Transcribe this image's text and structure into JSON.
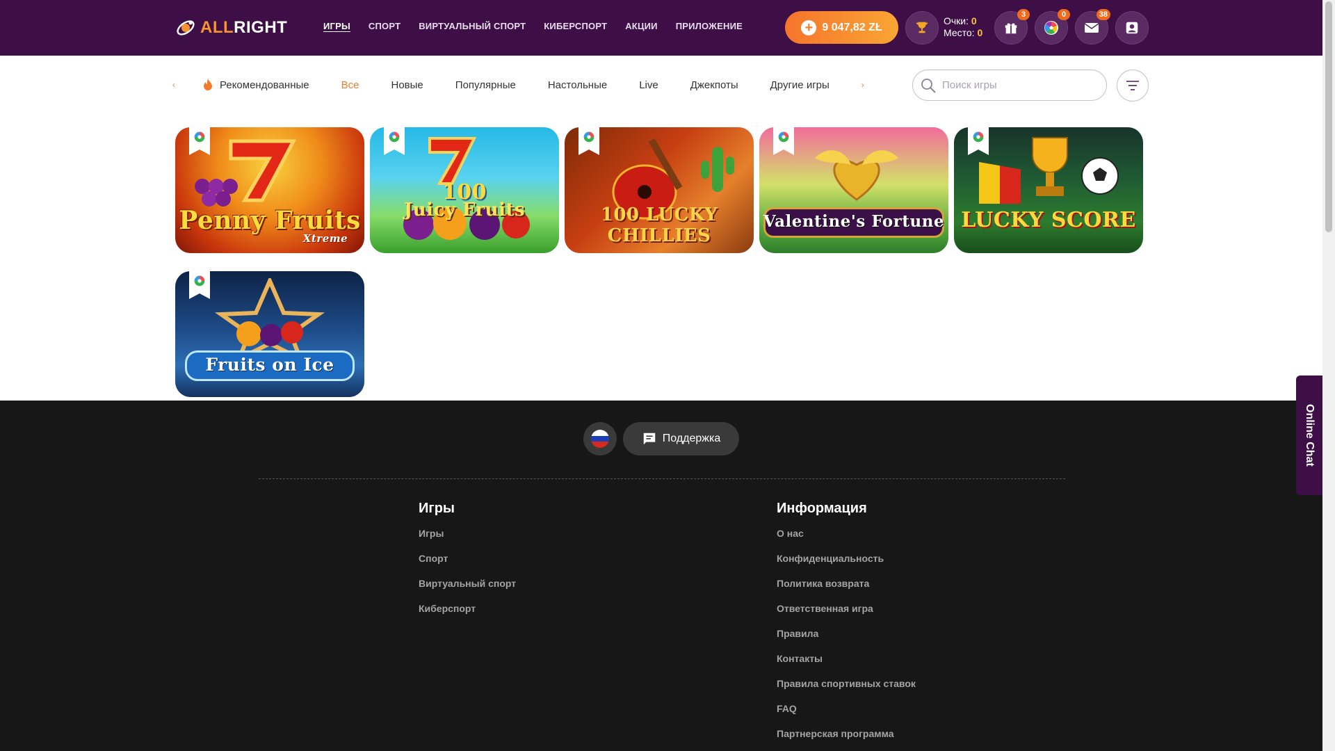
{
  "header": {
    "logo": {
      "prefix": "ALL",
      "suffix": "RIGHT"
    },
    "nav": [
      {
        "label": "ИГРЫ",
        "active": true
      },
      {
        "label": "СПОРТ"
      },
      {
        "label": "ВИРТУАЛЬНЫЙ СПОРТ"
      },
      {
        "label": "КИБЕРСПОРТ"
      },
      {
        "label": "АКЦИИ"
      },
      {
        "label": "ПРИЛОЖЕНИЕ"
      }
    ],
    "balance": "9 047,82 ZŁ",
    "points": {
      "points_label": "Очки:",
      "points_value": "0",
      "place_label": "Место:",
      "place_value": "0"
    },
    "badges": {
      "gifts": "3",
      "wheel": "0",
      "messages": "38"
    },
    "accent_color": "#f27a2c",
    "bg_color": "#3d0f46"
  },
  "categories": {
    "items": [
      "Рекомендованные",
      "Все",
      "Новые",
      "Популярные",
      "Настольные",
      "Live",
      "Джекпоты",
      "Другие игры"
    ],
    "active": "Все",
    "search_placeholder": "Поиск игры"
  },
  "games": [
    {
      "title": "Penny Fruits",
      "subtitle": "Xtreme"
    },
    {
      "title": "Juicy Fruits",
      "subtitle": "100"
    },
    {
      "title": "100 LUCKY CHILLIES",
      "subtitle": ""
    },
    {
      "title": "Valentine's Fortune",
      "subtitle": ""
    },
    {
      "title": "LUCKY SCORE",
      "subtitle": ""
    },
    {
      "title": "Fruits on Ice",
      "subtitle": ""
    }
  ],
  "footer": {
    "support_label": "Поддержка",
    "games_column": {
      "heading": "Игры",
      "links": [
        "Игры",
        "Спорт",
        "Виртуальный спорт",
        "Киберспорт"
      ]
    },
    "info_column": {
      "heading": "Информация",
      "links": [
        "О нас",
        "Конфиденциальность",
        "Политика возврата",
        "Ответственная игра",
        "Правила",
        "Контакты",
        "Правила спортивных ставок",
        "FAQ",
        "Партнерская программа"
      ]
    }
  },
  "online_chat": "Online Chat"
}
